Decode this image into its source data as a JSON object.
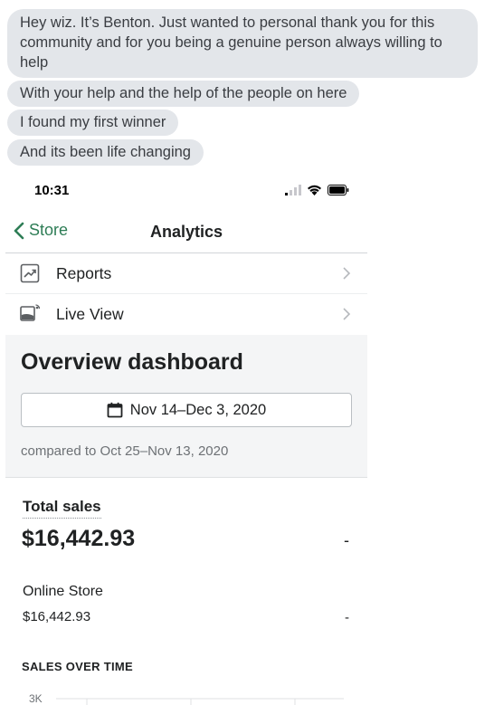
{
  "chat": {
    "messages": [
      "Hey wiz. It’s Benton. Just wanted to personal thank you for this community and for you being a genuine person always willing to help",
      "With your help and the help of the people on here",
      "I found my first winner",
      "And its been life changing"
    ]
  },
  "status_bar": {
    "time": "10:31",
    "icons": [
      "cellular-signal-icon",
      "wifi-icon",
      "battery-icon"
    ]
  },
  "nav": {
    "back_label": "Store",
    "title": "Analytics"
  },
  "menu": {
    "items": [
      {
        "label": "Reports",
        "icon": "reports-icon"
      },
      {
        "label": "Live View",
        "icon": "live-view-icon"
      }
    ]
  },
  "overview": {
    "title": "Overview dashboard",
    "date_range": "Nov 14–Dec 3, 2020",
    "compared": "compared to Oct 25–Nov 13, 2020"
  },
  "total_sales": {
    "label": "Total sales",
    "value": "$16,442.93",
    "change": "-"
  },
  "online_store": {
    "label": "Online Store",
    "value": "$16,442.93",
    "change": "-"
  },
  "sales_over_time": {
    "heading": "SALES OVER TIME",
    "y_tick_top": "3K"
  },
  "colors": {
    "accent_green": "#2e7d56",
    "bubble_bg": "#e3e6ea",
    "overview_bg": "#f4f5f6"
  }
}
